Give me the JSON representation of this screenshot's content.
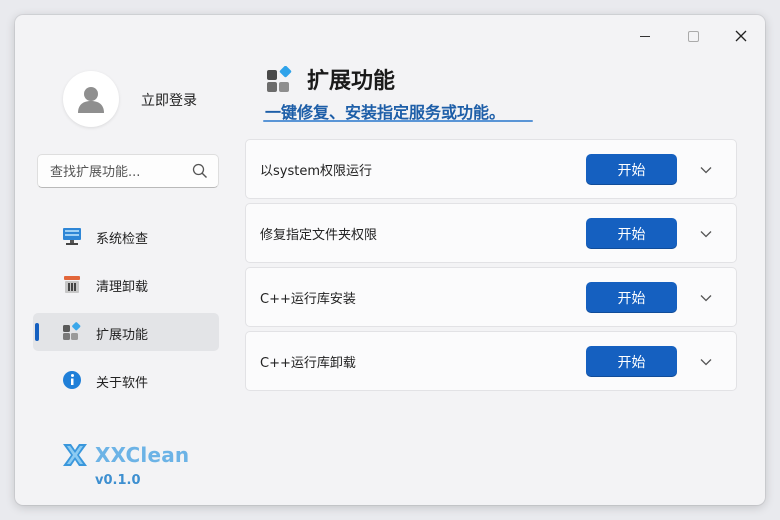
{
  "window": {
    "controls": [
      "minimize",
      "maximize",
      "close"
    ]
  },
  "sidebar": {
    "login_label": "立即登录",
    "search": {
      "placeholder": "查找扩展功能..."
    },
    "items": [
      {
        "label": "系统检查",
        "icon": "monitor-icon",
        "active": false
      },
      {
        "label": "清理卸载",
        "icon": "trash-icon",
        "active": false
      },
      {
        "label": "扩展功能",
        "icon": "extension-icon",
        "active": true
      },
      {
        "label": "关于软件",
        "icon": "info-icon",
        "active": false
      }
    ],
    "brand": {
      "name": "XXClean",
      "version": "v0.1.0"
    }
  },
  "main": {
    "title": "扩展功能",
    "subtitle": "一键修复、安装指定服务或功能。",
    "rows": [
      {
        "label": "以system权限运行",
        "button": "开始"
      },
      {
        "label": "修复指定文件夹权限",
        "button": "开始"
      },
      {
        "label": "C++运行库安装",
        "button": "开始"
      },
      {
        "label": "C++运行库卸载",
        "button": "开始"
      }
    ]
  },
  "colors": {
    "accent": "#1560c0",
    "brand": "#6cb3e6",
    "subtitle": "#1d5ea8"
  }
}
